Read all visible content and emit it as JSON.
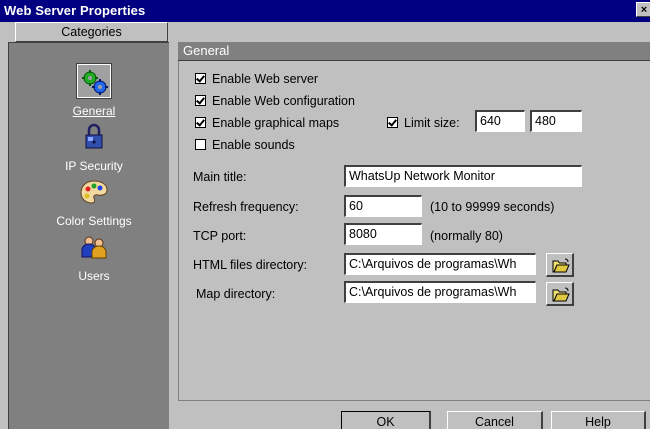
{
  "window": {
    "title": "Web Server Properties",
    "close_glyph": "×"
  },
  "sidebar": {
    "header": "Categories",
    "items": [
      {
        "label": "General",
        "icon": "gears-icon",
        "selected": true
      },
      {
        "label": "IP Security",
        "icon": "lock-icon",
        "selected": false
      },
      {
        "label": "Color Settings",
        "icon": "palette-icon",
        "selected": false
      },
      {
        "label": "Users",
        "icon": "users-icon",
        "selected": false
      }
    ]
  },
  "general": {
    "header": "General",
    "enable_web_server": {
      "label": "Enable Web server",
      "checked": true
    },
    "enable_web_configuration": {
      "label": "Enable Web configuration",
      "checked": true
    },
    "enable_graphical_maps": {
      "label": "Enable graphical maps",
      "checked": true
    },
    "limit_size": {
      "label": "Limit size:",
      "checked": true,
      "width": "640",
      "height": "480"
    },
    "enable_sounds": {
      "label": "Enable sounds",
      "checked": false
    },
    "main_title": {
      "label": "Main title:",
      "value": "WhatsUp Network Monitor"
    },
    "refresh_frequency": {
      "label": "Refresh frequency:",
      "value": "60",
      "hint": "(10 to 99999 seconds)"
    },
    "tcp_port": {
      "label": "TCP port:",
      "value": "8080",
      "hint": "(normally 80)"
    },
    "html_files_directory": {
      "label": "HTML files directory:",
      "value": "C:\\Arquivos de programas\\Wh"
    },
    "map_directory": {
      "label": "Map directory:",
      "value": "C:\\Arquivos de programas\\Wh"
    }
  },
  "buttons": {
    "ok": "OK",
    "cancel": "Cancel",
    "help": "Help"
  }
}
